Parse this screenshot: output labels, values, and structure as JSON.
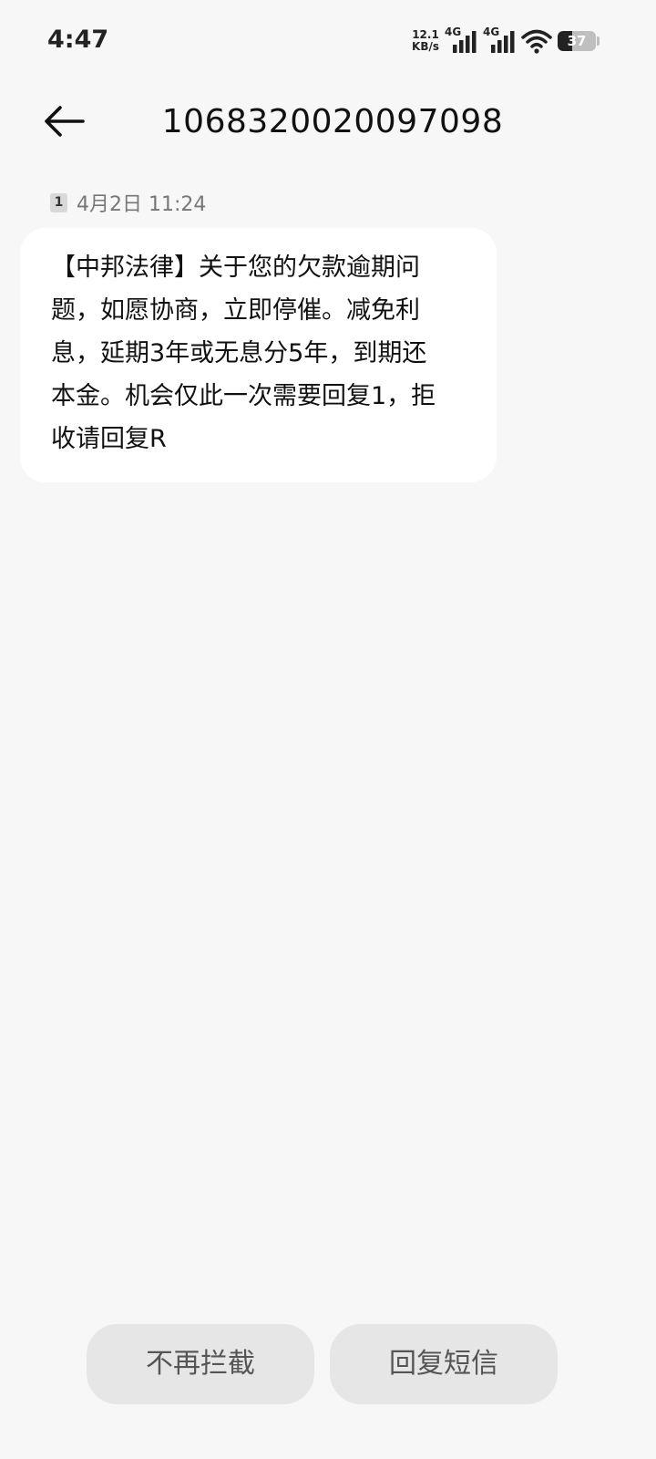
{
  "status_bar": {
    "time": "4:47",
    "net_speed_value": "12.1",
    "net_speed_unit": "KB/s",
    "sim1_label": "4G",
    "sim2_label": "4G",
    "battery_level": "37",
    "battery_fraction": 0.37
  },
  "header": {
    "title": "1068320020097098"
  },
  "message": {
    "sim_badge": "1",
    "timestamp": "4月2日 11:24",
    "lines": [
      "【中邦法律】关于您的欠款逾期问",
      "题，如愿协商，立即停催。减免利",
      "息，延期3年或无息分5年，到期还",
      "本金。机会仅此一次需要回复1，拒",
      "收请回复R"
    ]
  },
  "actions": {
    "unblock_label": "不再拦截",
    "reply_label": "回复短信"
  }
}
